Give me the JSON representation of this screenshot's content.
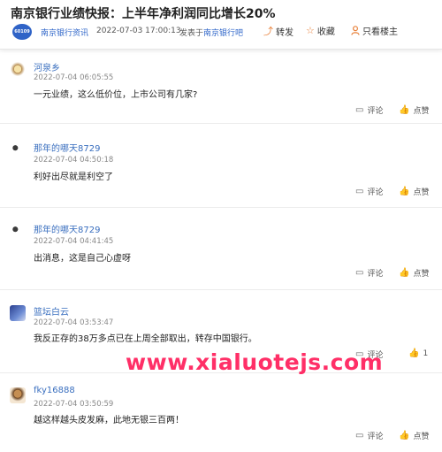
{
  "header": {
    "title": "南京银行业绩快报：上半年净利润同比增长20%",
    "forum_logo": "60109",
    "forum_name": "南京银行资讯",
    "time": "2022-07-03 17:00:13",
    "from_prefix": "发表于",
    "from_link": "南京银行吧",
    "share_label": "转发",
    "favorite_label": "收藏",
    "owner_only_label": "只看楼主"
  },
  "posts": [
    {
      "user": "河泉乡",
      "time": "2022-07-04 06:05:55",
      "text": "一元业绩，这么低价位，上市公司有几家?",
      "comment_label": "评论",
      "like_label": "点赞"
    },
    {
      "user": "那年的哪天8729",
      "time": "2022-07-04 04:50:18",
      "text": "利好出尽就是利空了",
      "comment_label": "评论",
      "like_label": "点赞"
    },
    {
      "user": "那年的哪天8729",
      "time": "2022-07-04 04:41:45",
      "text": "出消息，这是自己心虚呀",
      "comment_label": "评论",
      "like_label": "点赞"
    },
    {
      "user": "篮坛白云",
      "time": "2022-07-04 03:53:47",
      "text": "我反正存的38万多点已在上周全部取出，转存中国银行。",
      "comment_label": "评论",
      "like_label": "1"
    },
    {
      "user": "fky16888",
      "time": "2022-07-04 03:50:59",
      "text": "越这样越头皮发麻，此地无银三百两！",
      "comment_label": "评论",
      "like_label": "点赞"
    }
  ],
  "watermark": "www.xialuotejs.com",
  "icons": {
    "share": "share-icon",
    "favorite": "star-icon",
    "owner": "person-icon",
    "comment": "comment-icon",
    "like": "thumbs-up-icon"
  },
  "colors": {
    "link": "#3a6fbf",
    "accent": "#e8813a",
    "watermark": "#ff2f67"
  }
}
